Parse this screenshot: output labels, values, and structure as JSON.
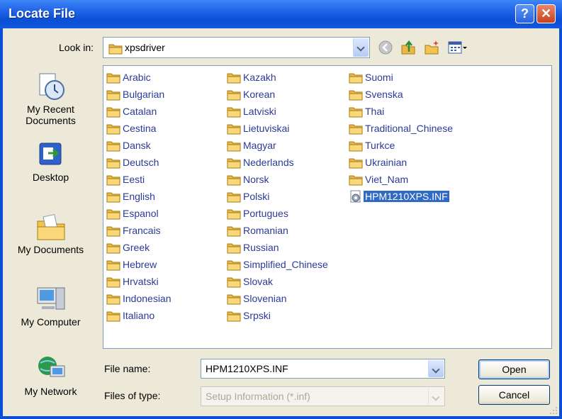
{
  "window": {
    "title": "Locate File"
  },
  "lookin": {
    "label": "Look in:",
    "value": "xpsdriver"
  },
  "places": [
    {
      "label": "My Recent Documents",
      "icon": "recent-documents-icon"
    },
    {
      "label": "Desktop",
      "icon": "desktop-icon"
    },
    {
      "label": "My Documents",
      "icon": "my-documents-icon"
    },
    {
      "label": "My Computer",
      "icon": "my-computer-icon"
    },
    {
      "label": "My Network",
      "icon": "my-network-icon"
    }
  ],
  "files": {
    "column1": [
      "Arabic",
      "Bulgarian",
      "Catalan",
      "Cestina",
      "Dansk",
      "Deutsch",
      "Eesti",
      "English",
      "Espanol",
      "Francais",
      "Greek",
      "Hebrew",
      "Hrvatski",
      "Indonesian",
      "Italiano"
    ],
    "column2": [
      "Kazakh",
      "Korean",
      "Latviski",
      "Lietuviskai",
      "Magyar",
      "Nederlands",
      "Norsk",
      "Polski",
      "Portugues",
      "Romanian",
      "Russian",
      "Simplified_Chinese",
      "Slovak",
      "Slovenian",
      "Srpski"
    ],
    "column3": [
      "Suomi",
      "Svenska",
      "Thai",
      "Traditional_Chinese",
      "Turkce",
      "Ukrainian",
      "Viet_Nam"
    ],
    "selected_file": "HPM1210XPS.INF"
  },
  "filename": {
    "label": "File name:",
    "value": "HPM1210XPS.INF"
  },
  "filetype": {
    "label": "Files of type:",
    "value": "Setup Information (*.inf)"
  },
  "buttons": {
    "open": "Open",
    "cancel": "Cancel"
  },
  "colors": {
    "title_bar": "#0b4fd6",
    "selection": "#316ac5",
    "file_text": "#2b3a96",
    "dialog_bg": "#ece9d8"
  }
}
